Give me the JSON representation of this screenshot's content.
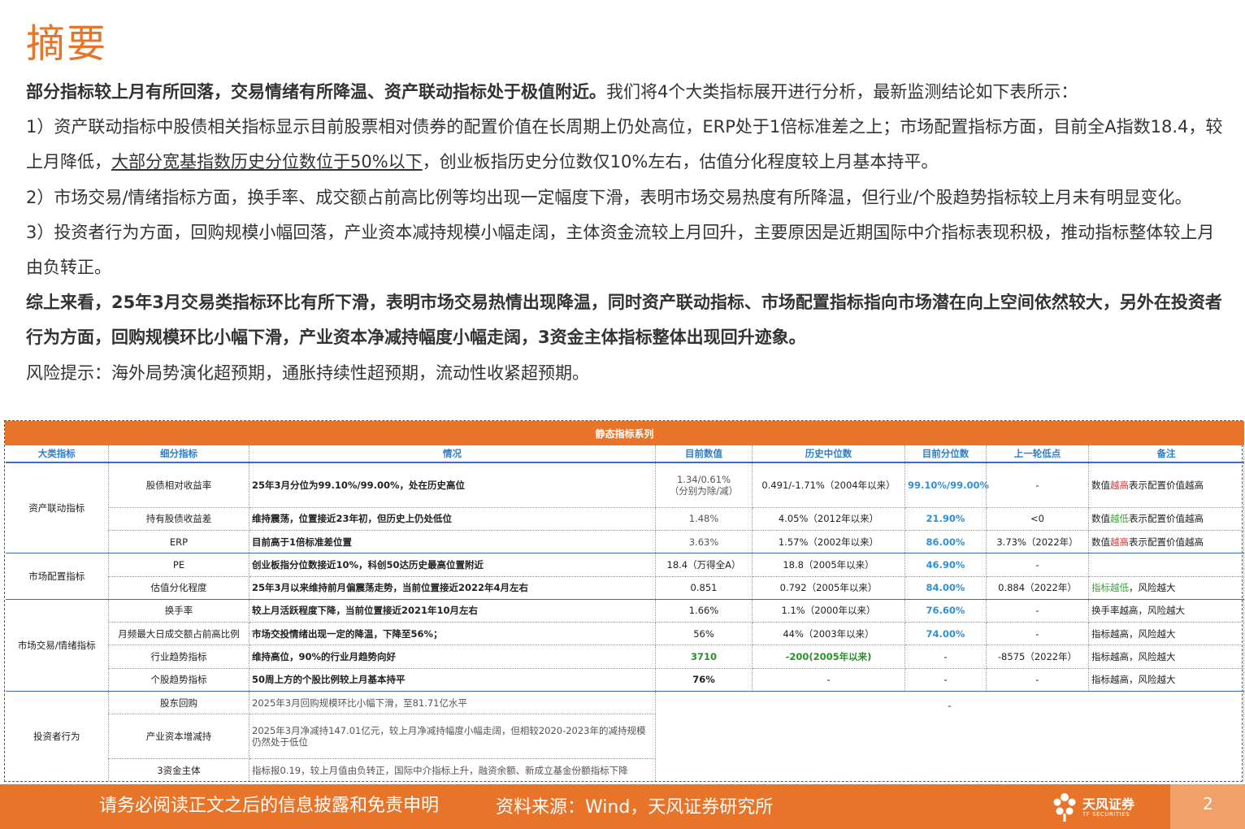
{
  "title": "摘要",
  "summary": {
    "p1_bold": "部分指标较上月有所回落，交易情绪有所降温、资产联动指标处于极值附近。",
    "p1_rest": "我们将4个大类指标展开进行分析，最新监测结论如下表所示：",
    "p2_a": "1）资产联动指标中股债相关指标显示目前股票相对债券的配置价值在长周期上仍处高位，ERP处于1倍标准差之上；市场配置指标方面，目前全A指数18.4，较上月降低，",
    "p2_u": "大部分宽基指数历史分位数位于50%以下",
    "p2_b": "，创业板指历史分位数仅10%左右，估值分化程度较上月基本持平。",
    "p3": "2）市场交易/情绪指标方面，换手率、成交额占前高比例等均出现一定幅度下滑，表明市场交易热度有所降温，但行业/个股趋势指标较上月未有明显变化。",
    "p4": "3）投资者行为方面，回购规模小幅回落，产业资本减持规模小幅走阔，主体资金流较上月回升，主要原因是近期国际中介指标表现积极，推动指标整体较上月由负转正。",
    "p5_bold": "综上来看，25年3月交易类指标环比有所下滑，表明市场交易热情出现降温，同时资产联动指标、市场配置指标指向市场潜在向上空间依然较大，另外在投资者行为方面，回购规模环比小幅下滑，产业资本净减持幅度小幅走阔，3资金主体指标整体出现回升迹象。",
    "p6": "风险提示：海外局势演化超预期，通胀持续性超预期，流动性收紧超预期。"
  },
  "table": {
    "title": "静态指标系列",
    "headers": [
      "大类指标",
      "细分指标",
      "情况",
      "目前数值",
      "历史中位数",
      "目前分位数",
      "上一轮低点",
      "备注"
    ],
    "categories": {
      "asset": "资产联动指标",
      "market": "市场配置指标",
      "trade": "市场交易/情绪指标",
      "investor": "投资者行为"
    },
    "rows": [
      {
        "sub": "股债相对收益率",
        "desc": "25年3月分位为99.10%/99.00%，处在历史高位",
        "cur": "1.34/0.61%",
        "cur2": "（分别为除/减）",
        "median": "0.491/-1.71%（2004年以来）",
        "pct": "99.10%/99.00%",
        "low": "-",
        "note_a": "数值",
        "note_hl": "越高",
        "note_b": "表示配置价值越高"
      },
      {
        "sub": "持有股债收益差",
        "desc": "维持震荡，位置接近23年初，但历史上仍处低位",
        "cur": "1.48%",
        "median": "4.05%（2012年以来）",
        "pct": "21.90%",
        "low": "<0",
        "note_a": "数值",
        "note_hl": "越低",
        "note_b": "表示配置价值越高"
      },
      {
        "sub": "ERP",
        "desc": "目前高于1倍标准差位置",
        "cur": "3.63%",
        "median": "1.57%（2002年以来）",
        "pct": "86.00%",
        "low": "3.73%（2022年）",
        "note_a": "数值",
        "note_hl": "越高",
        "note_b": "表示配置价值越高"
      },
      {
        "sub": "PE",
        "desc": "创业板指分位数接近10%，科创50达历史最高位置附近",
        "cur": "18.4（万得全A）",
        "median": "18.8（2005年以来）",
        "pct": "46.90%",
        "low": "-",
        "note_a": "",
        "note_hl": "",
        "note_b": ""
      },
      {
        "sub": "估值分化程度",
        "desc": "25年3月以来维持前月偏震荡走势，当前位置接近2022年4月左右",
        "cur": "0.851",
        "median": "0.792（2005年以来）",
        "pct": "84.00%",
        "low": "0.884（2022年）",
        "note_a": "",
        "note_hl": "指标越低",
        "note_b": "，风险越大"
      },
      {
        "sub": "换手率",
        "desc": "较上月活跃程度下降，当前位置接近2021年10月左右",
        "cur": "1.66%",
        "median": "1.1%（2000年以来）",
        "pct": "76.60%",
        "low": "-",
        "note_a": "换手率越高，风险越大",
        "note_hl": "",
        "note_b": ""
      },
      {
        "sub": "月频最大日成交额占前高比例",
        "desc": "市场交投情绪出现一定的降温，下降至56%；",
        "cur": "56%",
        "median": "44%（2003年以来）",
        "pct": "74.00%",
        "low": "-",
        "note_a": "指标越高，风险越大",
        "note_hl": "",
        "note_b": ""
      },
      {
        "sub": "行业趋势指标",
        "desc": "维持高位，90%的行业月趋势向好",
        "cur": "3710",
        "median": "-200(2005年以来)",
        "pct": "-",
        "low": "-8575（2022年）",
        "note_a": "指标越高，风险越大",
        "note_hl": "",
        "note_b": ""
      },
      {
        "sub": "个股趋势指标",
        "desc": "50周上方的个股比例较上月基本持平",
        "cur": "76%",
        "median": "-",
        "pct": "-",
        "low": "-",
        "note_a": "指标越高，风险越大",
        "note_hl": "",
        "note_b": ""
      },
      {
        "sub": "股东回购",
        "desc": "2025年3月回购规模环比小幅下滑，至81.71亿水平",
        "merged": "-"
      },
      {
        "sub": "产业资本增减持",
        "desc": "2025年3月净减持147.01亿元，较上月净减持幅度小幅走阔，但相较2020-2023年的减持规模仍然处于低位"
      },
      {
        "sub": "3资金主体",
        "desc": "指标报0.19，较上月值由负转正，国际中介指标上升，融资余额、新成立基金份额指标下降"
      }
    ]
  },
  "footer": {
    "disclaimer": "请务必阅读正文之后的信息披露和免责申明",
    "source": "资料来源：Wind，天风证券研究所",
    "logo_name": "天风证券",
    "logo_sub": "TF SECURITIES",
    "page": "2"
  },
  "colors": {
    "accent": "#e8742a",
    "header_blue": "#2f7ec7",
    "value_blue": "#2f8fd8",
    "green": "#2e8b2e",
    "red": "#e03030"
  }
}
